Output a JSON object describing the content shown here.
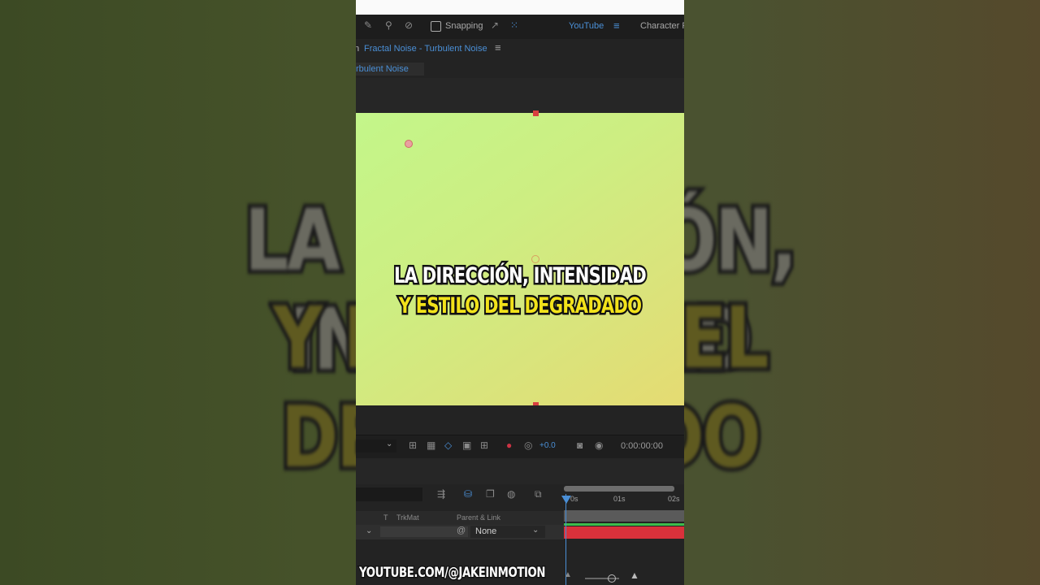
{
  "background": {
    "line1": "LA DIRECCIÓN, INTENSIDAD",
    "line2": "Y ESTILO DEL DEGRADADO"
  },
  "toolbar": {
    "snapping_label": "Snapping",
    "workspace_label": "YouTube",
    "workspace_menu_icon": "hamburger-icon",
    "next_workspace_label": "Character F"
  },
  "composition_panel": {
    "title": "Fractal Noise - Turbulent Noise",
    "subtab": "rbulent Noise",
    "prefix": "n"
  },
  "caption": {
    "line1": "LA DIRECCIÓN, INTENSIDAD",
    "line2": "Y ESTILO DEL DEGRADADO"
  },
  "viewer_controls": {
    "exposure": "+0.0",
    "timecode": "0:00:00:00"
  },
  "timeline": {
    "columns": {
      "t": "T",
      "trkmat": "TrkMat",
      "parent": "Parent & Link"
    },
    "row": {
      "parent_value": "None"
    },
    "ruler": [
      "0s",
      "01s",
      "02s"
    ],
    "track_color": "#d9313b",
    "track_top_color": "#3dbb4b"
  },
  "watermark": "YOUTUBE.COM/@JAKEINMOTION",
  "colors": {
    "accent": "#4a8fd6",
    "comp_start": "#c3f68a",
    "comp_end": "#e5db72"
  }
}
